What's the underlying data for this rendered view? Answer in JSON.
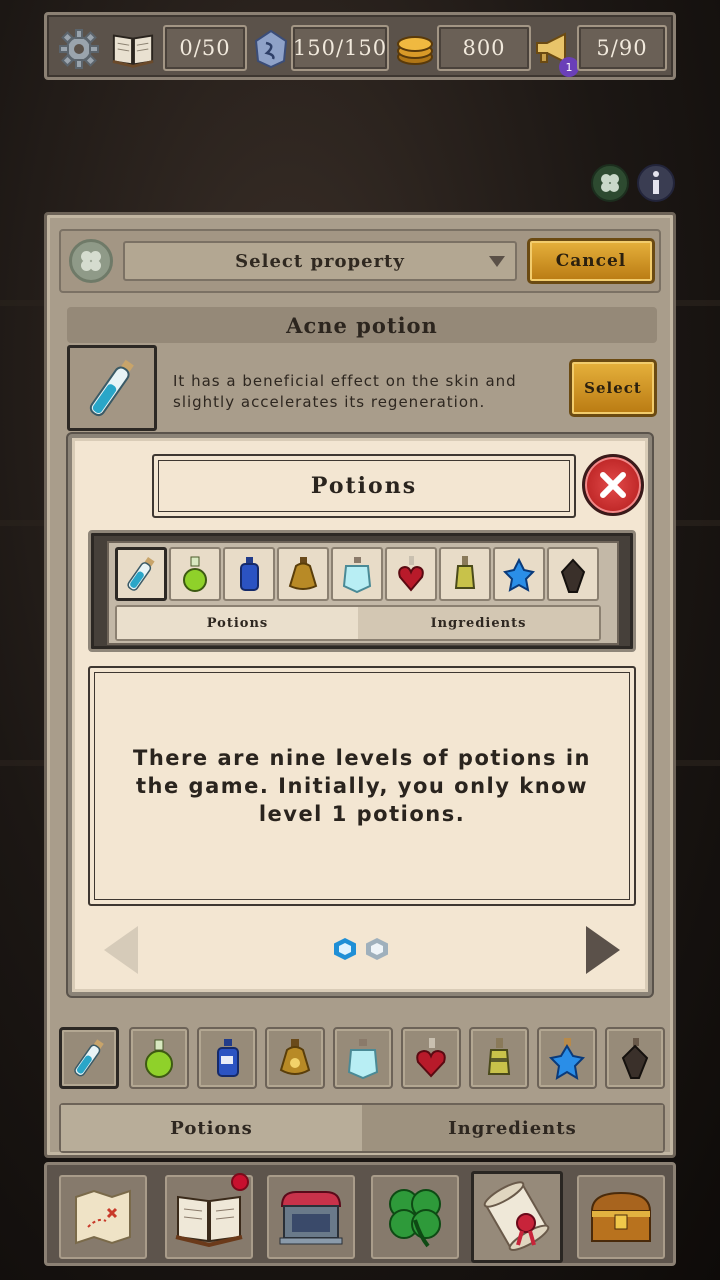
{
  "topbar": {
    "energy": "0/50",
    "mana": "150/150",
    "coins": "800",
    "quests": "5/90",
    "quest_badge": "1"
  },
  "panel": {
    "dropdown_label": "Select property",
    "cancel_label": "Cancel",
    "potion_name": "Acne potion",
    "potion_desc": "It has a beneficial effect on the skin and slightly accelerates its regeneration.",
    "select_label": "Select",
    "tabs": {
      "potions": "Potions",
      "ingredients": "Ingredients"
    }
  },
  "modal": {
    "title": "Potions",
    "tabs": {
      "potions": "Potions",
      "ingredients": "Ingredients"
    },
    "body": "There are nine levels of potions in the game. Initially, you only know level 1 potions.",
    "pager": {
      "current": 1,
      "total": 2
    }
  },
  "potion_icons": [
    "vial-blue-icon",
    "flask-green-icon",
    "bottle-blue-icon",
    "flask-gold-icon",
    "crystal-flask-icon",
    "heart-flask-red-icon",
    "ornate-flask-yellow-icon",
    "star-flask-blue-icon",
    "dark-flask-icon"
  ],
  "nav": [
    "map-icon",
    "book-icon",
    "shop-icon",
    "clover-icon",
    "scroll-icon",
    "chest-icon"
  ],
  "colors": {
    "gold": "#d9a22e",
    "close_red": "#d62c2c",
    "parchment": "#f3e6d2"
  }
}
